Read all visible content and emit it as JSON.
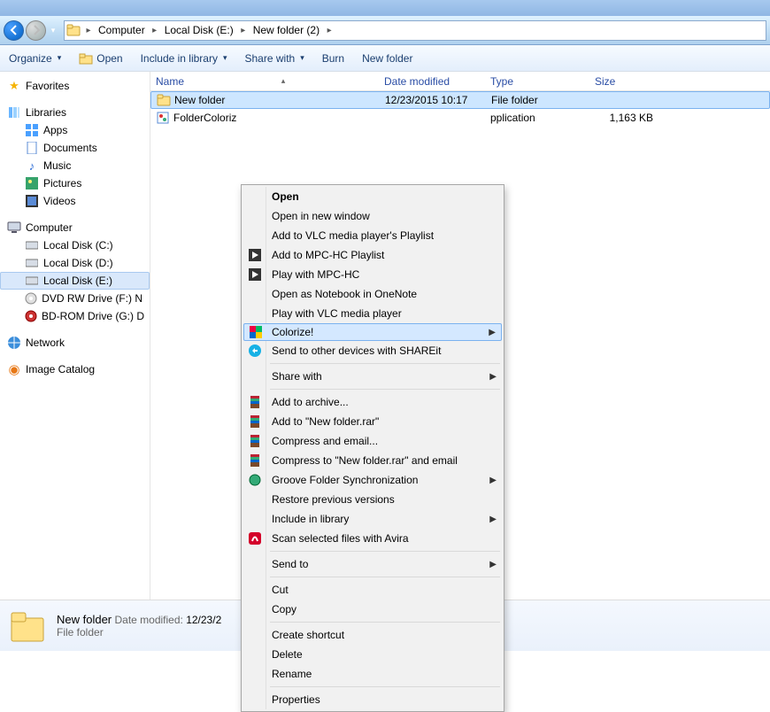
{
  "breadcrumb": {
    "segments": [
      "Computer",
      "Local Disk (E:)",
      "New folder (2)"
    ]
  },
  "toolbar": {
    "organize": "Organize",
    "open": "Open",
    "include": "Include in library",
    "share": "Share with",
    "burn": "Burn",
    "newfolder": "New folder"
  },
  "sidebar": {
    "favorites": "Favorites",
    "libraries": "Libraries",
    "lib_items": [
      "Apps",
      "Documents",
      "Music",
      "Pictures",
      "Videos"
    ],
    "computer": "Computer",
    "drives": [
      "Local Disk (C:)",
      "Local Disk (D:)",
      "Local Disk (E:)",
      "DVD RW Drive (F:)  N",
      "BD-ROM Drive (G:) D"
    ],
    "network": "Network",
    "imagecatalog": "Image Catalog"
  },
  "columns": {
    "name": "Name",
    "date": "Date modified",
    "type": "Type",
    "size": "Size"
  },
  "files": [
    {
      "name": "New folder",
      "date": "12/23/2015 10:17",
      "type": "File folder",
      "size": ""
    },
    {
      "name": "FolderColoriz",
      "date": "",
      "type": "pplication",
      "size": "1,163 KB"
    }
  ],
  "context_menu": {
    "groups": [
      [
        {
          "label": "Open",
          "bold": true
        },
        {
          "label": "Open in new window"
        },
        {
          "label": "Add to VLC media player's Playlist"
        },
        {
          "label": "Add to MPC-HC Playlist",
          "icon": "mpc"
        },
        {
          "label": "Play with MPC-HC",
          "icon": "mpc"
        },
        {
          "label": "Open as Notebook in OneNote"
        },
        {
          "label": "Play with VLC media player"
        },
        {
          "label": "Colorize!",
          "icon": "colorize",
          "submenu": true,
          "hover": true
        },
        {
          "label": "Send to other devices with SHAREit",
          "icon": "shareit"
        }
      ],
      [
        {
          "label": "Share with",
          "submenu": true
        }
      ],
      [
        {
          "label": "Add to archive...",
          "icon": "rar"
        },
        {
          "label": "Add to \"New folder.rar\"",
          "icon": "rar"
        },
        {
          "label": "Compress and email...",
          "icon": "rar"
        },
        {
          "label": "Compress to \"New folder.rar\" and email",
          "icon": "rar"
        },
        {
          "label": "Groove Folder Synchronization",
          "icon": "groove",
          "submenu": true
        },
        {
          "label": "Restore previous versions"
        },
        {
          "label": "Include in library",
          "submenu": true
        },
        {
          "label": "Scan selected files with Avira",
          "icon": "avira"
        }
      ],
      [
        {
          "label": "Send to",
          "submenu": true
        }
      ],
      [
        {
          "label": "Cut"
        },
        {
          "label": "Copy"
        }
      ],
      [
        {
          "label": "Create shortcut"
        },
        {
          "label": "Delete"
        },
        {
          "label": "Rename"
        }
      ],
      [
        {
          "label": "Properties"
        }
      ]
    ]
  },
  "details": {
    "name": "New folder",
    "date_label": "Date modified:",
    "date": "12/23/2",
    "type": "File folder"
  }
}
